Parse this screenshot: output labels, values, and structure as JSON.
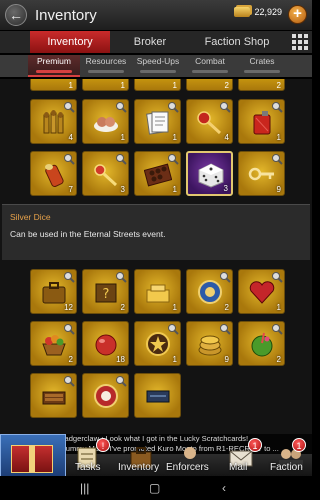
{
  "header": {
    "title": "Inventory",
    "gold_amount": "22,929"
  },
  "tabs": [
    {
      "label": "Inventory",
      "active": true
    },
    {
      "label": "Broker",
      "active": false
    },
    {
      "label": "Faction Shop",
      "active": false
    }
  ],
  "subtabs": [
    {
      "label": "Premium",
      "active": true
    },
    {
      "label": "Resources",
      "active": false
    },
    {
      "label": "Speed-Ups",
      "active": false
    },
    {
      "label": "Combat",
      "active": false
    },
    {
      "label": "Crates",
      "active": false
    }
  ],
  "partial_row_counts": [
    "1",
    "1",
    "1",
    "2",
    "2"
  ],
  "items_top": [
    {
      "icon": "bullets-icon",
      "count": "4"
    },
    {
      "icon": "pastry-icon",
      "count": "1"
    },
    {
      "icon": "documents-icon",
      "count": "1"
    },
    {
      "icon": "red-key-icon",
      "count": "4"
    },
    {
      "icon": "fuel-can-icon",
      "count": "1"
    },
    {
      "icon": "cocktail-icon",
      "count": "7"
    },
    {
      "icon": "golden-key-icon",
      "count": "3"
    },
    {
      "icon": "chocolates-icon",
      "count": "1"
    },
    {
      "icon": "dice-icon",
      "count": "3",
      "selected": true
    },
    {
      "icon": "gold-key-icon",
      "count": "9"
    }
  ],
  "description": {
    "name": "Silver Dice",
    "text": "Can be used in the Eternal Streets event."
  },
  "items_bottom": [
    {
      "icon": "briefcase-icon",
      "count": "12"
    },
    {
      "icon": "mystery-crate-icon",
      "count": "2"
    },
    {
      "icon": "gold-bars-icon",
      "count": "1"
    },
    {
      "icon": "poker-chip-icon",
      "count": "2"
    },
    {
      "icon": "heart-box-icon",
      "count": "1"
    },
    {
      "icon": "paper-crane-icon",
      "count": "1"
    },
    {
      "icon": "fruit-basket-icon",
      "count": "2"
    },
    {
      "icon": "bauble-icon",
      "count": "18"
    },
    {
      "icon": "star-badge-icon",
      "count": "1"
    },
    {
      "icon": "gold-coins-icon",
      "count": "9"
    },
    {
      "icon": "coconut-drink-icon",
      "count": "2"
    },
    {
      "icon": "cigar-box-icon",
      "count": ""
    },
    {
      "icon": "roulette-chip-icon",
      "count": ""
    },
    {
      "icon": "ticket-icon",
      "count": ""
    }
  ],
  "chat": [
    "[hoT] Badgerclaw : Look what I got in the Lucky Scratchcards!",
    "[hoT] Mummy Moo : I've promoted Kuro Monto from R1-RECRUIT to ..."
  ],
  "bottom_nav": [
    {
      "label": "Tasks",
      "badge": "!"
    },
    {
      "label": "Inventory",
      "badge": ""
    },
    {
      "label": "Enforcers",
      "badge": ""
    },
    {
      "label": "Mail",
      "badge": "1"
    },
    {
      "label": "Faction",
      "badge": "1"
    }
  ],
  "colors": {
    "accent_red": "#c92b2b",
    "gold_slot": "#d6a51c",
    "selected_slot": "#5b2486",
    "item_name": "#e6a14a"
  }
}
